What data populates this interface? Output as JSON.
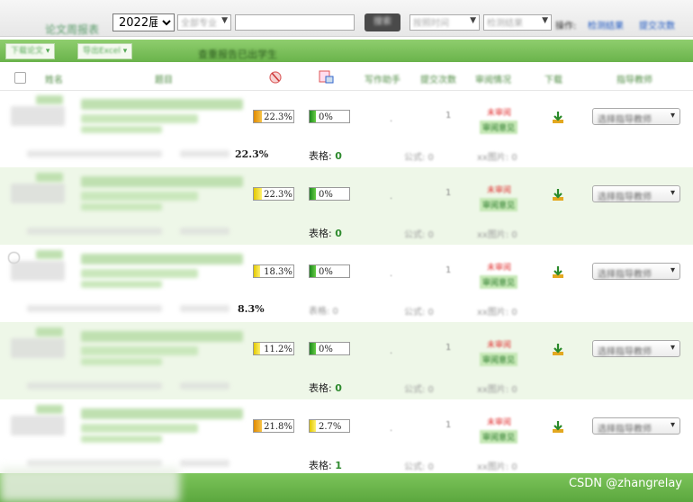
{
  "toolbar": {
    "title": "论文周报表",
    "year": "2022届",
    "year_options": [
      "2022届"
    ],
    "major_select": "全部专业",
    "search_placeholder": "",
    "search_button": "搜索",
    "sort_select": "按照时间",
    "result_select": "检测结果",
    "prefix_text": "操作:",
    "link1": "检测结果",
    "link2": "提交次数"
  },
  "actionbar": {
    "download_label": "下载论文",
    "export_label": "导出Excel",
    "title": "查重报告已出学生"
  },
  "header": {
    "name": "姓名",
    "topic": "题目",
    "write_count": "写作助手",
    "submit_count": "提交次数",
    "review": "审阅情况",
    "download": "下载",
    "teacher": "指导教师"
  },
  "rows": [
    {
      "pct1": "22.3%",
      "pct1_fill": 0.223,
      "pct1_color": "orange",
      "pct2": "0%",
      "pct2_fill": 0.0,
      "pct2_color": "green",
      "sub_pct": "22.3%",
      "table_label": "表格: ",
      "table_count": "0",
      "count": "1",
      "status_red": "未审阅",
      "status_green": "审阅意见",
      "teacher_select": "选择指导教师"
    },
    {
      "pct1": "22.3%",
      "pct1_fill": 0.223,
      "pct1_color": "yellow",
      "pct2": "0%",
      "pct2_fill": 0.0,
      "pct2_color": "green",
      "sub_pct": "",
      "table_label": "表格: ",
      "table_count": "0",
      "count": "1",
      "status_red": "未审阅",
      "status_green": "审阅意见",
      "teacher_select": "选择指导教师"
    },
    {
      "pct1": "18.3%",
      "pct1_fill": 0.183,
      "pct1_color": "yellow",
      "pct2": "0%",
      "pct2_fill": 0.0,
      "pct2_color": "green",
      "sub_pct": "8.3%",
      "table_label": "",
      "table_count": "",
      "count": "1",
      "status_red": "未审阅",
      "status_green": "审阅意见",
      "teacher_select": "选择指导教师"
    },
    {
      "pct1": "11.2%",
      "pct1_fill": 0.112,
      "pct1_color": "yellow",
      "pct2": "0%",
      "pct2_fill": 0.0,
      "pct2_color": "green",
      "sub_pct": "",
      "table_label": "表格: ",
      "table_count": "0",
      "count": "1",
      "status_red": "未审阅",
      "status_green": "审阅意见",
      "teacher_select": "选择指导教师"
    },
    {
      "pct1": "21.8%",
      "pct1_fill": 0.218,
      "pct1_color": "orange",
      "pct2": "2.7%",
      "pct2_fill": 0.027,
      "pct2_color": "yellow",
      "sub_pct": "",
      "table_label": "表格: ",
      "table_count": "1",
      "count": "1",
      "status_red": "未审阅",
      "status_green": "审阅意见",
      "teacher_select": "选择指导教师"
    }
  ],
  "watermark": "CSDN @zhangrelay"
}
